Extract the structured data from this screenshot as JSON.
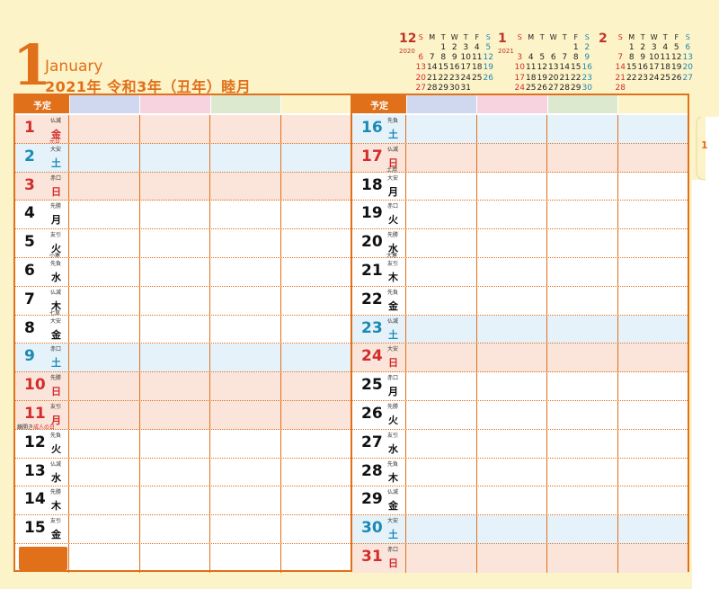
{
  "header": {
    "month_number": "1",
    "month_en": "January",
    "year_line": "2021年 令和3年（丑年）睦月",
    "tab_label": "1"
  },
  "mini_calendars": [
    {
      "month": "12",
      "year": "2020",
      "weekdays": [
        "S",
        "M",
        "T",
        "W",
        "T",
        "F",
        "S"
      ],
      "weeks": [
        [
          "",
          "",
          "1",
          "2",
          "3",
          "4",
          "5"
        ],
        [
          "6",
          "7",
          "8",
          "9",
          "10",
          "11",
          "12"
        ],
        [
          "13",
          "14",
          "15",
          "16",
          "17",
          "18",
          "19"
        ],
        [
          "20",
          "21",
          "22",
          "23",
          "24",
          "25",
          "26"
        ],
        [
          "27",
          "28",
          "29",
          "30",
          "31",
          "",
          ""
        ]
      ]
    },
    {
      "month": "1",
      "year": "2021",
      "weekdays": [
        "S",
        "M",
        "T",
        "W",
        "T",
        "F",
        "S"
      ],
      "weeks": [
        [
          "",
          "",
          "",
          "",
          "",
          "1",
          "2"
        ],
        [
          "3",
          "4",
          "5",
          "6",
          "7",
          "8",
          "9"
        ],
        [
          "10",
          "11",
          "12",
          "13",
          "14",
          "15",
          "16"
        ],
        [
          "17",
          "18",
          "19",
          "20",
          "21",
          "22",
          "23"
        ],
        [
          "24",
          "25",
          "26",
          "27",
          "28",
          "29",
          "30"
        ],
        [
          "31",
          "",
          "",
          "",
          "",
          "",
          ""
        ]
      ]
    },
    {
      "month": "2",
      "year": "",
      "weekdays": [
        "S",
        "M",
        "T",
        "W",
        "T",
        "F",
        "S"
      ],
      "weeks": [
        [
          "",
          "1",
          "2",
          "3",
          "4",
          "5",
          "6"
        ],
        [
          "7",
          "8",
          "9",
          "10",
          "11",
          "12",
          "13"
        ],
        [
          "14",
          "15",
          "16",
          "17",
          "18",
          "19",
          "20"
        ],
        [
          "21",
          "22",
          "23",
          "24",
          "25",
          "26",
          "27"
        ],
        [
          "28",
          "",
          "",
          "",
          "",
          "",
          ""
        ]
      ]
    }
  ],
  "column_header": {
    "label": "予定"
  },
  "left_days": [
    {
      "d": "1",
      "w": "金",
      "r": "仏滅",
      "note": "元日",
      "type": "red",
      "noteRed": true
    },
    {
      "d": "2",
      "w": "土",
      "r": "大安",
      "type": "blue"
    },
    {
      "d": "3",
      "w": "日",
      "r": "赤口",
      "type": "red"
    },
    {
      "d": "4",
      "w": "月",
      "r": "先勝"
    },
    {
      "d": "5",
      "w": "火",
      "r": "友引",
      "note": "小寒"
    },
    {
      "d": "6",
      "w": "水",
      "r": "先負"
    },
    {
      "d": "7",
      "w": "木",
      "r": "仏滅",
      "note": "七草"
    },
    {
      "d": "8",
      "w": "金",
      "r": "大安"
    },
    {
      "d": "9",
      "w": "土",
      "r": "赤口",
      "type": "blue"
    },
    {
      "d": "10",
      "w": "日",
      "r": "先勝",
      "type": "red"
    },
    {
      "d": "11",
      "w": "月",
      "r": "友引",
      "type": "red",
      "noteLeft": "鏡開き",
      "note": "成人の日",
      "noteRed": true
    },
    {
      "d": "12",
      "w": "火",
      "r": "先負"
    },
    {
      "d": "13",
      "w": "水",
      "r": "仏滅"
    },
    {
      "d": "14",
      "w": "木",
      "r": "先勝"
    },
    {
      "d": "15",
      "w": "金",
      "r": "友引"
    }
  ],
  "right_days": [
    {
      "d": "16",
      "w": "土",
      "r": "先負",
      "type": "blue"
    },
    {
      "d": "17",
      "w": "日",
      "r": "仏滅",
      "note": "土用",
      "type": "red"
    },
    {
      "d": "18",
      "w": "月",
      "r": "大安"
    },
    {
      "d": "19",
      "w": "火",
      "r": "赤口"
    },
    {
      "d": "20",
      "w": "水",
      "r": "先勝",
      "note": "大寒"
    },
    {
      "d": "21",
      "w": "木",
      "r": "友引"
    },
    {
      "d": "22",
      "w": "金",
      "r": "先負"
    },
    {
      "d": "23",
      "w": "土",
      "r": "仏滅",
      "type": "blue"
    },
    {
      "d": "24",
      "w": "日",
      "r": "大安",
      "type": "red"
    },
    {
      "d": "25",
      "w": "月",
      "r": "赤口"
    },
    {
      "d": "26",
      "w": "火",
      "r": "先勝"
    },
    {
      "d": "27",
      "w": "水",
      "r": "友引"
    },
    {
      "d": "28",
      "w": "木",
      "r": "先負"
    },
    {
      "d": "29",
      "w": "金",
      "r": "仏滅"
    },
    {
      "d": "30",
      "w": "土",
      "r": "大安",
      "type": "blue"
    },
    {
      "d": "31",
      "w": "日",
      "r": "赤口",
      "type": "red"
    }
  ],
  "colors": {
    "accent": "#e0701a",
    "paper": "#fdf3c8",
    "holiday_row": "#fbe5da",
    "saturday_row": "#e6f2fa",
    "col1": "#cfd8ef",
    "col2": "#f7d3df",
    "col3": "#dde9cf",
    "col4": "#fdf3c8"
  }
}
